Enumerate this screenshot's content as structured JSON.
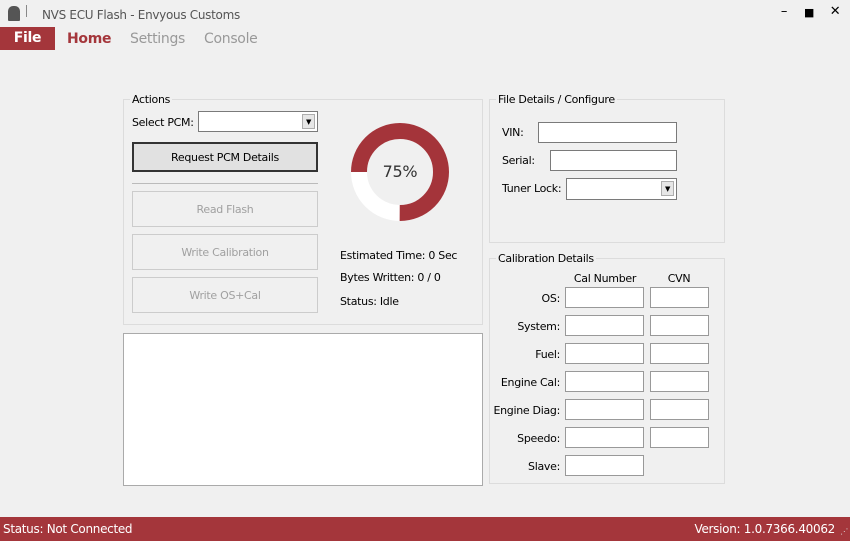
{
  "window": {
    "title": "NVS ECU Flash - Envyous Customs",
    "minimize": "–",
    "maximize": "■",
    "close": "✕"
  },
  "menu": {
    "file": "File",
    "tabs": [
      {
        "label": "Home",
        "active": true
      },
      {
        "label": "Settings"
      },
      {
        "label": "Console"
      }
    ]
  },
  "actions": {
    "label": "Actions",
    "select_pcm_label": "Select PCM:",
    "select_pcm_value": "",
    "request_button": "Request PCM Details",
    "read_flash": "Read Flash",
    "write_calibration": "Write Calibration",
    "write_os_cal": "Write OS+Cal"
  },
  "progress": {
    "percent": 75,
    "text": "75%",
    "estimated_time": "Estimated Time: 0 Sec",
    "bytes_written": "Bytes Written: 0 / 0",
    "status": "Status: Idle",
    "colors": {
      "fill": "#a4343a",
      "track": "#ffffff"
    }
  },
  "file_details": {
    "label": "File Details / Configure",
    "vin_label": "VIN:",
    "vin": "",
    "serial_label": "Serial:",
    "serial": "",
    "tuner_lock_label": "Tuner Lock:",
    "tuner_lock": ""
  },
  "calibration": {
    "label": "Calibration Details",
    "col_cal": "Cal Number",
    "col_cvn": "CVN",
    "rows": [
      {
        "label": "OS:",
        "cal": "",
        "cvn": ""
      },
      {
        "label": "System:",
        "cal": "",
        "cvn": ""
      },
      {
        "label": "Fuel:",
        "cal": "",
        "cvn": ""
      },
      {
        "label": "Engine Cal:",
        "cal": "",
        "cvn": ""
      },
      {
        "label": "Engine Diag:",
        "cal": "",
        "cvn": ""
      },
      {
        "label": "Speedo:",
        "cal": "",
        "cvn": ""
      },
      {
        "label": "Slave:",
        "cal": ""
      }
    ]
  },
  "log": {
    "text": ""
  },
  "statusbar": {
    "status": "Status: Not Connected",
    "version": "Version: 1.0.7366.40062"
  },
  "theme": {
    "accent": "#a4363b"
  }
}
